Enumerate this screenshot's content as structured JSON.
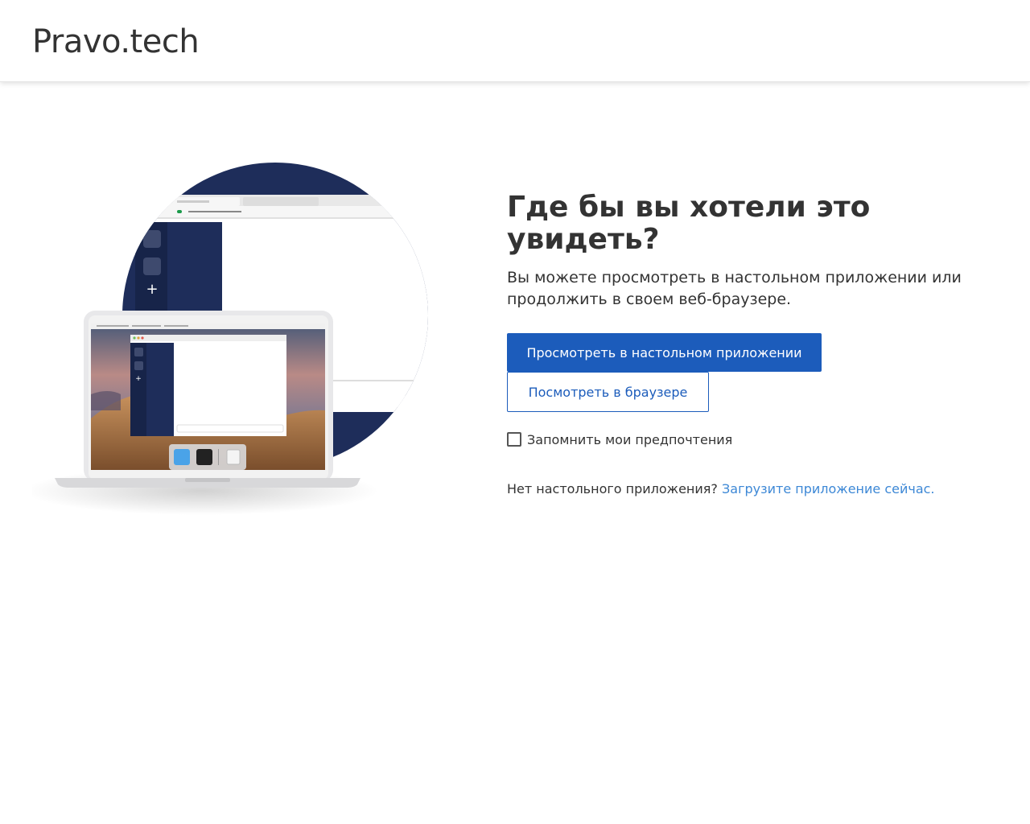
{
  "header": {
    "brand": "Pravo.tech"
  },
  "main": {
    "heading": "Где бы вы хотели это увидеть?",
    "subtext": "Вы можете просмотреть в настольном приложении или продолжить в своем веб-браузере.",
    "open_desktop_label": "Просмотреть в настольном приложении",
    "open_browser_label": "Посмотреть в браузере",
    "remember_label": "Запомнить мои предпочтения",
    "remember_checked": false,
    "no_app_text": "Нет настольного приложения?",
    "download_link": "Загрузите приложение сейчас."
  },
  "colors": {
    "primary": "#1c5cbb",
    "link": "#3d88d6",
    "text": "#333333",
    "illustration_circle": "#1e2d5a"
  }
}
